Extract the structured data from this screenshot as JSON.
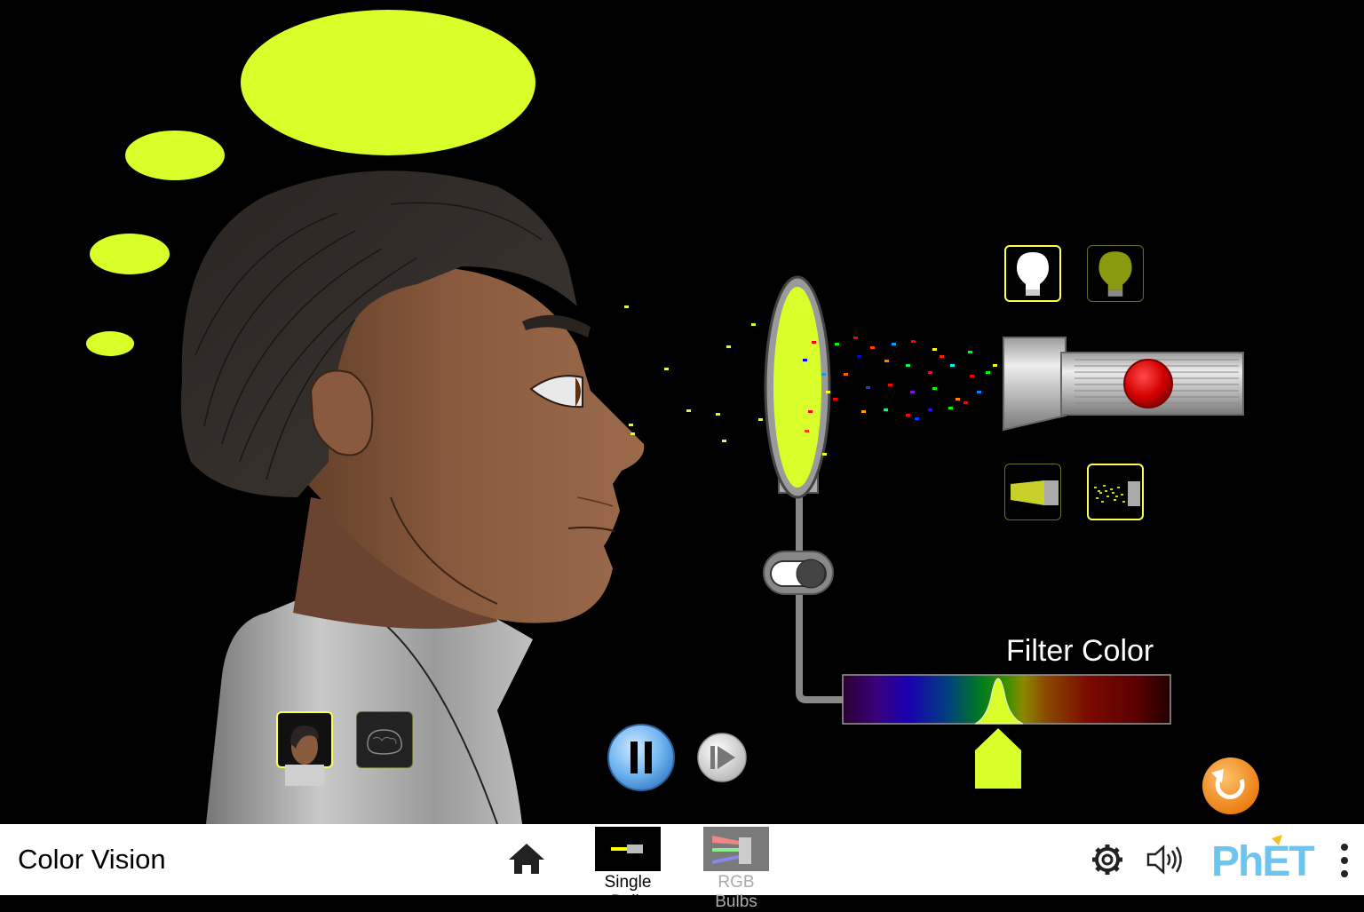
{
  "app": {
    "title": "Color Vision",
    "brand": "PhET"
  },
  "colors": {
    "perceived": "#d8ff2a",
    "filter": "#d8ff2a",
    "selection": "#ffff4e",
    "background": "#000000",
    "navbar": "#ffffff"
  },
  "filter_control": {
    "label": "Filter Color"
  },
  "light_type": {
    "selected": "white-bulb"
  },
  "beam_mode": {
    "selected": "photon"
  },
  "view_mode": {
    "selected": "head"
  },
  "playback": {
    "state": "playing"
  },
  "filter_toggle": {
    "on": false
  },
  "screens": {
    "single_bulb": "Single Bulb",
    "rgb_bulbs": "RGB Bulbs",
    "selected": "single_bulb"
  },
  "icons": {
    "home": "home-icon",
    "settings": "gear-icon",
    "sound": "speaker-icon",
    "menu": "kebab-menu-icon",
    "reset": "reset-icon"
  }
}
